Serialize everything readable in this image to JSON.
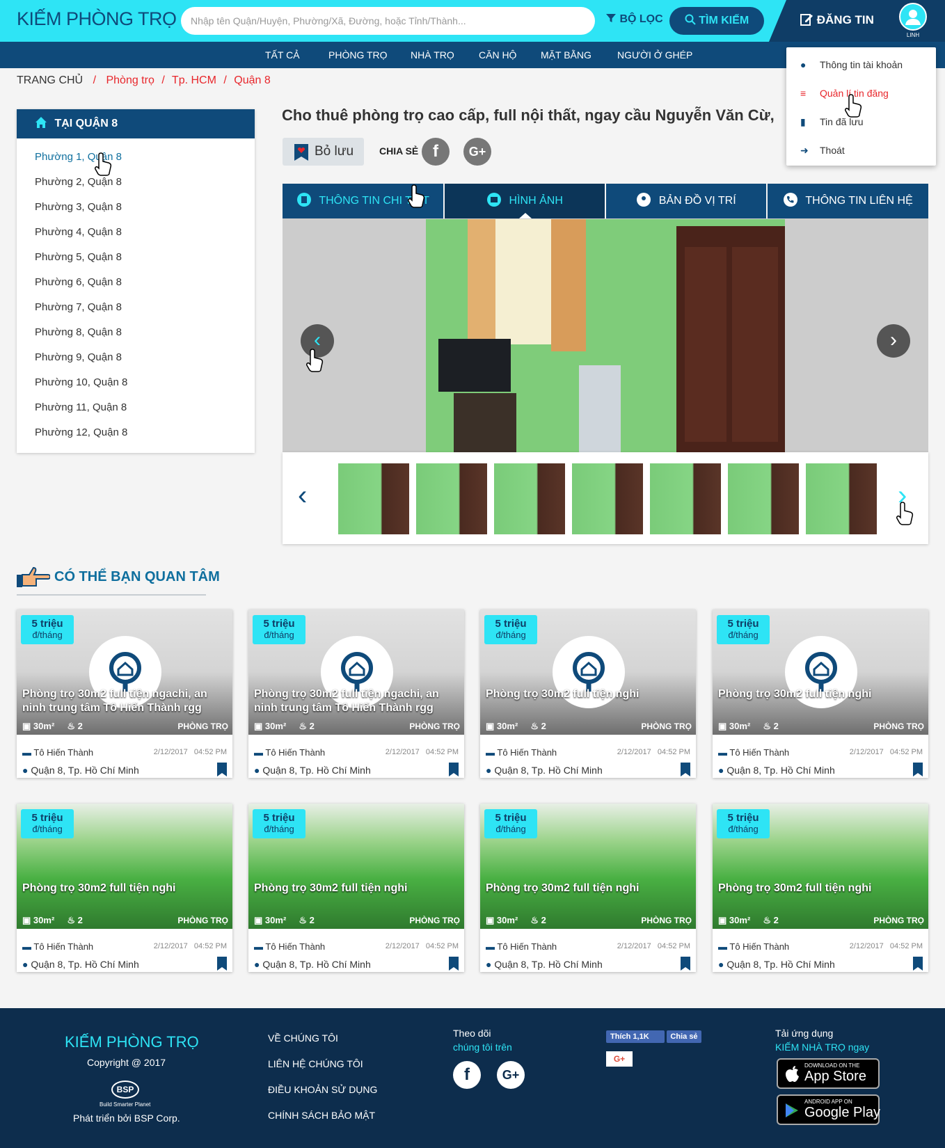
{
  "colors": {
    "accent": "#2ee4f5",
    "primary": "#0f4a7a",
    "footer": "#0d2d4d",
    "red": "#e8262b"
  },
  "header": {
    "logo": "KIẾM PHÒNG TRỌ",
    "search_placeholder": "Nhập tên Quận/Huyện, Phường/Xã, Đường, hoặc Tỉnh/Thành...",
    "filter_label": "BỘ LỌC",
    "search_button": "TÌM KIẾM",
    "post_button": "ĐĂNG TIN",
    "user_name": "LINH"
  },
  "nav": [
    "TẤT CẢ",
    "PHÒNG TRỌ",
    "NHÀ TRỌ",
    "CĂN HỘ",
    "MẶT BẰNG",
    "NGƯỜI Ở GHÉP"
  ],
  "user_menu": [
    {
      "label": "Thông tin tài khoản",
      "icon": "user-icon",
      "active": false
    },
    {
      "label": "Quản lí tin đăng",
      "icon": "list-icon",
      "active": true
    },
    {
      "label": "Tin đã lưu",
      "icon": "bookmark-icon",
      "active": false
    },
    {
      "label": "Thoát",
      "icon": "logout-icon",
      "active": false
    }
  ],
  "breadcrumb": {
    "home": "TRANG CHỦ",
    "sep": "/",
    "items": [
      "Phòng trọ",
      "Tp. HCM",
      "Quận 8"
    ]
  },
  "sidebar": {
    "title": "TẠI QUẬN 8",
    "items": [
      "Phường 1, Quận 8",
      "Phường 2, Quận 8",
      "Phường 3, Quận 8",
      "Phường 4, Quận 8",
      "Phường 5, Quận 8",
      "Phường 6, Quận 8",
      "Phường 7, Quận 8",
      "Phường 8, Quận 8",
      "Phường 9, Quận 8",
      "Phường 10, Quận 8",
      "Phường 11, Quận 8",
      "Phường 12, Quận 8"
    ]
  },
  "post": {
    "title": "Cho thuê phòng trọ cao cấp, full nội thất, ngay cầu Nguyễn Văn Cừ,",
    "save_label": "Bỏ lưu",
    "share_label": "CHIA SẺ"
  },
  "tabs": [
    {
      "label": "THÔNG TIN  CHI TIẾT",
      "icon": "document-icon",
      "active": false
    },
    {
      "label": "HÌNH ẢNH",
      "icon": "image-icon",
      "active": true
    },
    {
      "label": "BẢN ĐỒ VỊ TRÍ",
      "icon": "map-pin-icon",
      "active": false
    },
    {
      "label": "THÔNG TIN LIÊN HỆ",
      "icon": "phone-icon",
      "active": false
    }
  ],
  "related": {
    "title": "CÓ THỂ BẠN QUAN TÂM",
    "cards": [
      {
        "price": "5 triệu",
        "unit": "đ/tháng",
        "title": "Phòng trọ 30m2 full tiện ngachi, an ninh trung tâm Tô Hiến Thành rgg",
        "area": "30m²",
        "wc": "2",
        "type": "PHÒNG TRỌ",
        "owner": "Tô Hiến Thành",
        "date": "2/12/2017",
        "time": "04:52 PM",
        "address": "Quận 8, Tp. Hồ Chí Minh",
        "image": "placeholder"
      },
      {
        "price": "5 triệu",
        "unit": "đ/tháng",
        "title": "Phòng trọ 30m2 full tiện ngachi, an ninh trung tâm Tô Hiến Thành rgg",
        "area": "30m²",
        "wc": "2",
        "type": "PHÒNG TRỌ",
        "owner": "Tô Hiến Thành",
        "date": "2/12/2017",
        "time": "04:52 PM",
        "address": "Quận 8, Tp. Hồ Chí Minh",
        "image": "placeholder"
      },
      {
        "price": "5 triệu",
        "unit": "đ/tháng",
        "title": "Phòng trọ 30m2 full tiện nghi",
        "area": "30m²",
        "wc": "2",
        "type": "PHÒNG TRỌ",
        "owner": "Tô Hiến Thành",
        "date": "2/12/2017",
        "time": "04:52 PM",
        "address": "Quận 8, Tp. Hồ Chí Minh",
        "image": "placeholder"
      },
      {
        "price": "5 triệu",
        "unit": "đ/tháng",
        "title": "Phòng trọ 30m2 full tiện nghi",
        "area": "30m²",
        "wc": "2",
        "type": "PHÒNG TRỌ",
        "owner": "Tô Hiến Thành",
        "date": "2/12/2017",
        "time": "04:52 PM",
        "address": "Quận 8, Tp. Hồ Chí Minh",
        "image": "placeholder"
      },
      {
        "price": "5 triệu",
        "unit": "đ/tháng",
        "title": "Phòng trọ 30m2 full tiện nghi",
        "area": "30m²",
        "wc": "2",
        "type": "PHÒNG TRỌ",
        "owner": "Tô Hiến Thành",
        "date": "2/12/2017",
        "time": "04:52 PM",
        "address": "Quận 8, Tp. Hồ Chí Minh",
        "image": "photo"
      },
      {
        "price": "5 triệu",
        "unit": "đ/tháng",
        "title": "Phòng trọ 30m2 full tiện nghi",
        "area": "30m²",
        "wc": "2",
        "type": "PHÒNG TRỌ",
        "owner": "Tô Hiến Thành",
        "date": "2/12/2017",
        "time": "04:52 PM",
        "address": "Quận 8, Tp. Hồ Chí Minh",
        "image": "photo"
      },
      {
        "price": "5 triệu",
        "unit": "đ/tháng",
        "title": "Phòng trọ 30m2 full tiện nghi",
        "area": "30m²",
        "wc": "2",
        "type": "PHÒNG TRỌ",
        "owner": "Tô Hiến Thành",
        "date": "2/12/2017",
        "time": "04:52 PM",
        "address": "Quận 8, Tp. Hồ Chí Minh",
        "image": "photo"
      },
      {
        "price": "5 triệu",
        "unit": "đ/tháng",
        "title": "Phòng trọ 30m2 full tiện nghi",
        "area": "30m²",
        "wc": "2",
        "type": "PHÒNG TRỌ",
        "owner": "Tô Hiến Thành",
        "date": "2/12/2017",
        "time": "04:52 PM",
        "address": "Quận 8, Tp. Hồ Chí Minh",
        "image": "photo"
      }
    ]
  },
  "footer": {
    "logo": "KIẾM PHÒNG TRỌ",
    "copyright": "Copyright @ 2017",
    "bsp_logo": "BSP",
    "bsp_tagline": "Build Smarter Planet",
    "developed_by": "Phát triển bởi BSP Corp.",
    "links": [
      "VỀ CHÚNG TÔI",
      "LIÊN HỆ CHÚNG TÔI",
      "ĐIỀU KHOẢN SỬ DỤNG",
      "CHÍNH SÁCH BẢO MẬT"
    ],
    "follow": "Theo dõi",
    "follow_sub": "chúng tôi trên",
    "fb_like": "Thích",
    "fb_count": "1,1K",
    "fb_share": "Chia sẻ",
    "gplus": "G+",
    "app_title": "Tải ứng dụng",
    "app_sub": "KIẾM NHÀ TRỌ ngay",
    "appstore_small": "DOWNLOAD ON THE",
    "appstore": "App Store",
    "googleplay_small": "ANDROID APP ON",
    "googleplay": "Google Play"
  }
}
